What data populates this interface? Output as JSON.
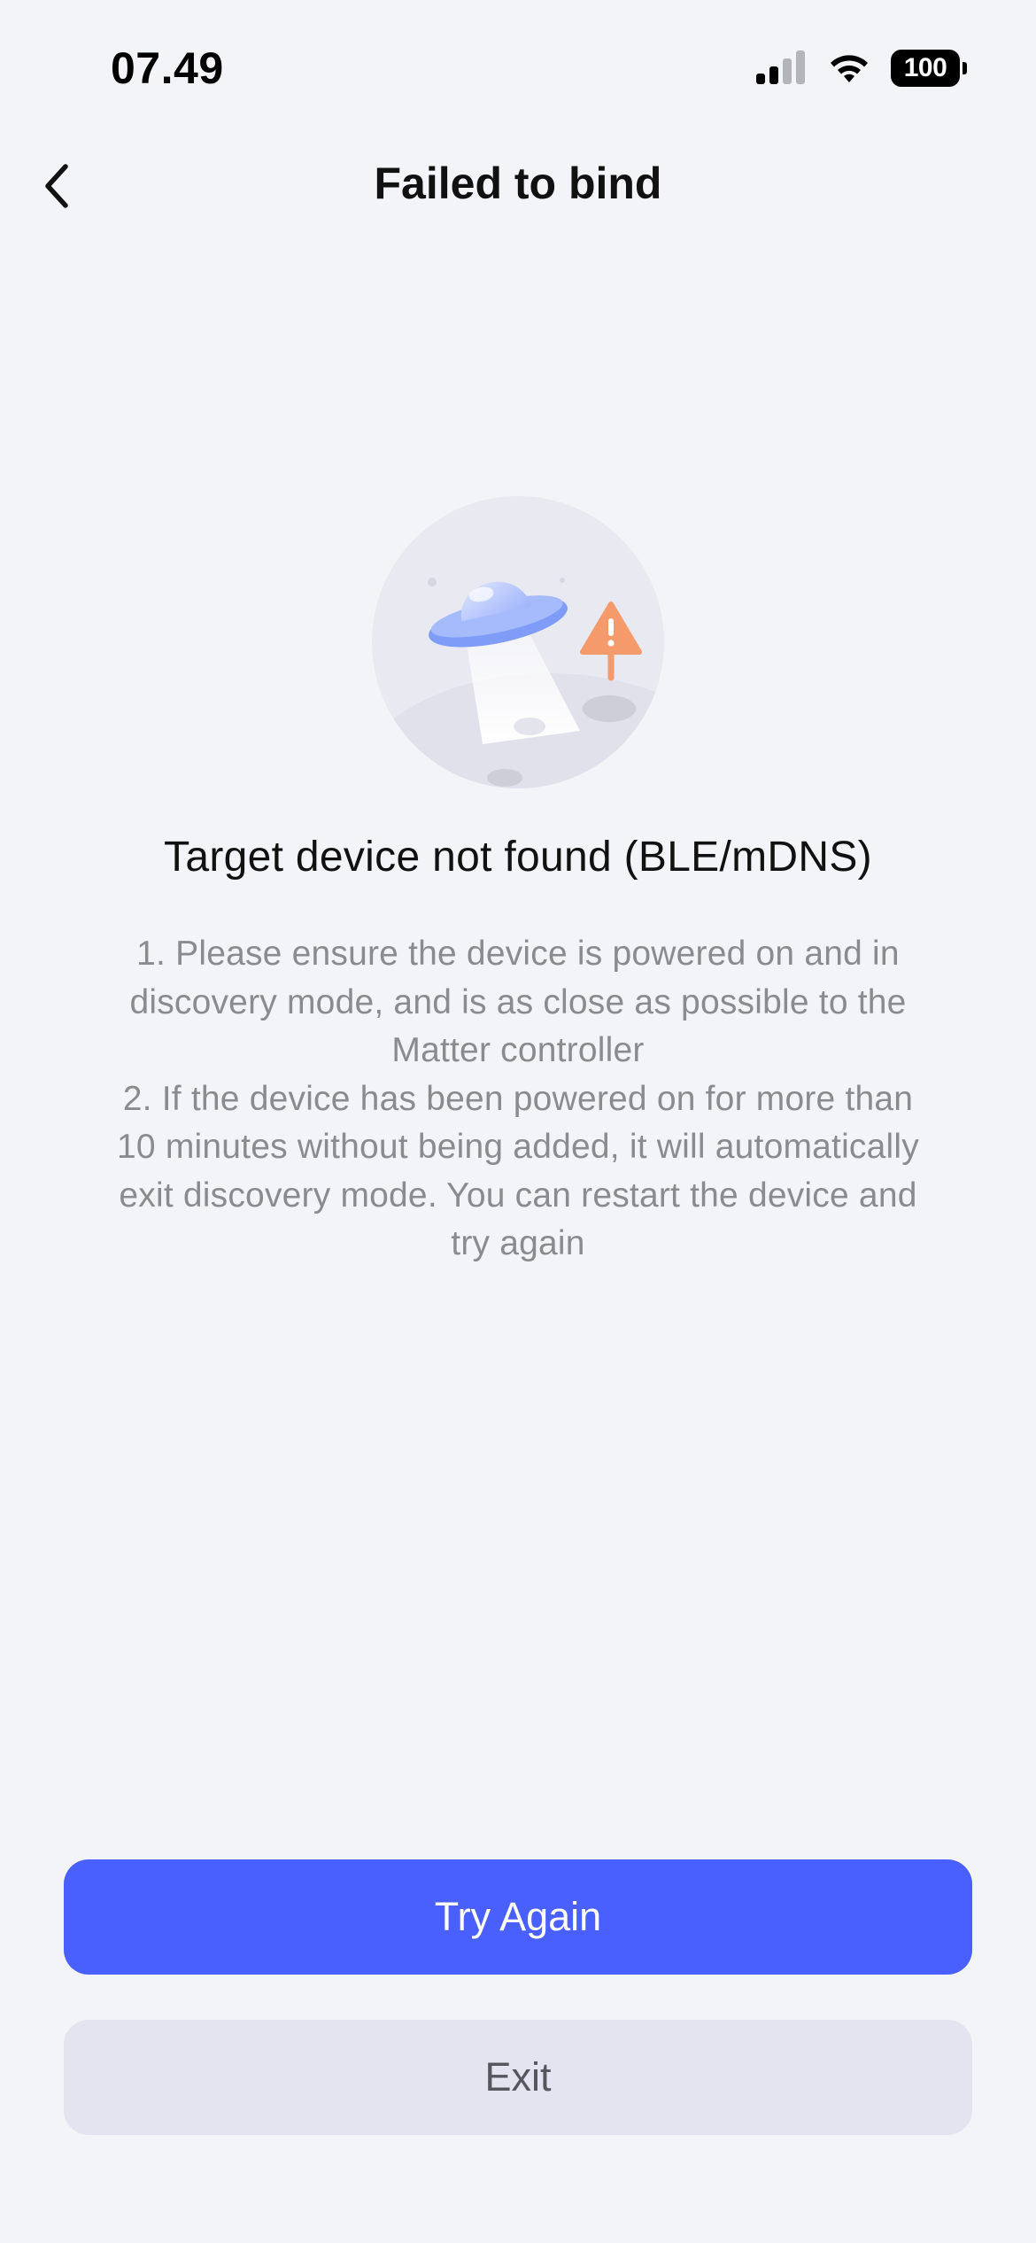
{
  "status_bar": {
    "time": "07.49",
    "battery": "100",
    "icons": [
      "cellular-signal-icon",
      "wifi-icon",
      "battery-icon"
    ]
  },
  "header": {
    "title": "Failed to bind",
    "back_icon": "chevron-left-icon"
  },
  "illustration": {
    "icon": "ufo-warning-illustration",
    "colors": {
      "circle": "#e8e9f1",
      "ufo": "#7f9cf8",
      "warning": "#f59a6b"
    }
  },
  "error": {
    "heading": "Target device not found (BLE/mDNS)",
    "tips": [
      "1. Please ensure the device is powered on and in discovery mode, and is as close as possible to the Matter controller",
      "2. If the device has been powered on for more than 10 minutes without being added, it will automatically exit discovery mode. You can restart the device and try again"
    ]
  },
  "actions": {
    "try_again_label": "Try Again",
    "exit_label": "Exit"
  },
  "colors": {
    "background": "#f3f4f8",
    "primary": "#4a60fe",
    "secondary": "#e3e4ef",
    "muted_text": "#8a8b91"
  }
}
